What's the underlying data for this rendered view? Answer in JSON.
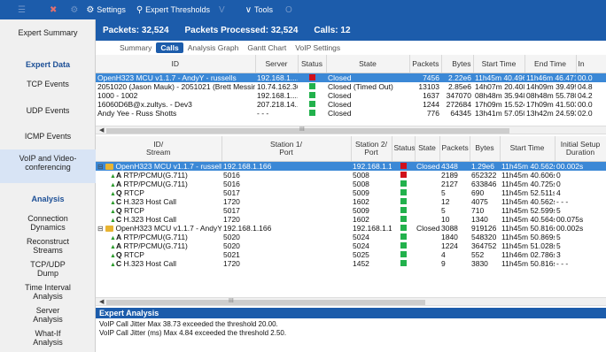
{
  "toolbar": {
    "ghosts": [
      "☰",
      "✖",
      "⚙"
    ],
    "settings": "Settings",
    "thresholds": "Expert Thresholds",
    "ghost_mid": "V",
    "tools": "Tools",
    "ghost_end": "O"
  },
  "sidebar": {
    "expert_summary": "Expert Summary",
    "expert_data_head": "Expert Data",
    "tcp_events": "TCP Events",
    "udp_events": "UDP Events",
    "icmp_events": "ICMP Events",
    "voip_video": "VoIP and Video-conferencing",
    "analysis_head": "Analysis",
    "connection_dynamics": "Connection Dynamics",
    "reconstruct_streams": "Reconstruct Streams",
    "tcp_udp_dump": "TCP/UDP Dump",
    "time_interval": "Time Interval Analysis",
    "server_analysis": "Server Analysis",
    "what_if": "What-If Analysis"
  },
  "stats": {
    "packets": "Packets: 32,524",
    "processed": "Packets Processed: 32,524",
    "calls": "Calls: 12"
  },
  "tabs": [
    "Summary",
    "Calls",
    "Analysis Graph",
    "Gantt Chart",
    "VoIP Settings"
  ],
  "calls_table": {
    "headers": [
      "ID",
      "Server",
      "Status",
      "State",
      "Packets",
      "Bytes",
      "Start Time",
      "End Time",
      "In"
    ],
    "rows": [
      {
        "id": "OpenH323 MCU v1.1.7 - AndyY - russells",
        "server": "192.168.1....",
        "status": "red",
        "state": "Closed",
        "packets": "7456",
        "bytes": "2.22e6",
        "start": "11h45m 40.496s",
        "end": "11h46m 46.471s",
        "extra": "00.0"
      },
      {
        "id": "2051020 (Jason Mauk) - 2051021 (Brett Messinger)",
        "server": "10.74.162.36",
        "status": "green",
        "state": "Closed (Timed Out)",
        "packets": "13103",
        "bytes": "2.85e6",
        "start": "14h07m 20.408s",
        "end": "14h09m 39.499s",
        "extra": "04.8"
      },
      {
        "id": "1000 - 1002",
        "server": "192.168.1....",
        "status": "green",
        "state": "Closed",
        "packets": "1637",
        "bytes": "347070",
        "start": "08h48m 35.948s",
        "end": "08h48m 55.780s",
        "extra": "04.2"
      },
      {
        "id": "16060D6B@x.zultys. - Dev3",
        "server": "207.218.14...",
        "status": "green",
        "state": "Closed",
        "packets": "1244",
        "bytes": "272684",
        "start": "17h09m 15.524s",
        "end": "17h09m 41.503s",
        "extra": "00.0"
      },
      {
        "id": "Andy Yee - Russ Shotts",
        "server": "- - -",
        "status": "green",
        "state": "Closed",
        "packets": "776",
        "bytes": "64345",
        "start": "13h41m 57.050s",
        "end": "13h42m 24.593s",
        "extra": "02.0"
      }
    ]
  },
  "scroll_mid": "III",
  "streams_table": {
    "headers": [
      "ID/\nStream",
      "Station 1/\nPort",
      "Station 2/\nPort",
      "Status",
      "State",
      "Packets",
      "Bytes",
      "Start Time",
      "Initial Setup\nDuration"
    ],
    "rows": [
      {
        "kind": "call",
        "expand": "⊟",
        "id": "OpenH323 MCU v1.1.7 - russells",
        "st1": "192.168.1.166",
        "st2": "192.168.1.173",
        "status": "red",
        "state": "Closed",
        "packets": "4348",
        "bytes": "1.29e6",
        "start": "11h45m 40.562s",
        "setup": "00.002s",
        "selected": true
      },
      {
        "kind": "stream",
        "letter": "A",
        "id": "RTP/PCMU(G.711)",
        "st1": "5016",
        "st2": "5008",
        "status": "red",
        "state": "",
        "packets": "2189",
        "bytes": "652322",
        "start": "11h45m 40.606s",
        "setup": "0"
      },
      {
        "kind": "stream",
        "letter": "A",
        "id": "RTP/PCMU(G.711)",
        "st1": "5016",
        "st2": "5008",
        "status": "green",
        "state": "",
        "packets": "2127",
        "bytes": "633846",
        "start": "11h45m 40.725s",
        "setup": "0"
      },
      {
        "kind": "stream",
        "letter": "Q",
        "id": "RTCP",
        "st1": "5017",
        "st2": "5009",
        "status": "green",
        "state": "",
        "packets": "5",
        "bytes": "690",
        "start": "11h45m 52.511s",
        "setup": "4"
      },
      {
        "kind": "stream",
        "letter": "C",
        "id": "H.323 Host Call",
        "st1": "1720",
        "st2": "1602",
        "status": "green",
        "state": "",
        "packets": "12",
        "bytes": "4075",
        "start": "11h45m 40.562s",
        "setup": "- - -"
      },
      {
        "kind": "stream",
        "letter": "Q",
        "id": "RTCP",
        "st1": "5017",
        "st2": "5009",
        "status": "green",
        "state": "",
        "packets": "5",
        "bytes": "710",
        "start": "11h45m 52.599s",
        "setup": "5"
      },
      {
        "kind": "stream",
        "letter": "C",
        "id": "H.323 Host Call",
        "st1": "1720",
        "st2": "1602",
        "status": "green",
        "state": "",
        "packets": "10",
        "bytes": "1340",
        "start": "11h45m 40.564s",
        "setup": "00.075s"
      },
      {
        "kind": "call",
        "expand": "⊟",
        "id": "OpenH323 MCU v1.1.7 - AndyY",
        "st1": "192.168.1.166",
        "st2": "192.168.1.167",
        "status": "green",
        "state": "Closed",
        "packets": "3088",
        "bytes": "919126",
        "start": "11h45m 50.816s",
        "setup": "00.002s"
      },
      {
        "kind": "stream",
        "letter": "A",
        "id": "RTP/PCMU(G.711)",
        "st1": "5020",
        "st2": "5024",
        "status": "green",
        "state": "",
        "packets": "1840",
        "bytes": "548320",
        "start": "11h45m 50.869s",
        "setup": "5"
      },
      {
        "kind": "stream",
        "letter": "A",
        "id": "RTP/PCMU(G.711)",
        "st1": "5020",
        "st2": "5024",
        "status": "green",
        "state": "",
        "packets": "1224",
        "bytes": "364752",
        "start": "11h45m 51.028s",
        "setup": "5"
      },
      {
        "kind": "stream",
        "letter": "Q",
        "id": "RTCP",
        "st1": "5021",
        "st2": "5025",
        "status": "green",
        "state": "",
        "packets": "4",
        "bytes": "552",
        "start": "11h46m 02.786s",
        "setup": "3"
      },
      {
        "kind": "stream",
        "letter": "C",
        "id": "H.323 Host Call",
        "st1": "1720",
        "st2": "1452",
        "status": "green",
        "state": "",
        "packets": "9",
        "bytes": "3830",
        "start": "11h45m 50.816s",
        "setup": "- - -"
      }
    ]
  },
  "expert_analysis": {
    "title": "Expert Analysis",
    "lines": [
      "VoIP Call Jitter Max 38.73 exceeded the threshold 20.00.",
      "VoIP Call Jitter (ms) Max 4.84 exceeded the threshold 2.50."
    ]
  },
  "colors": {
    "accent": "#1c5cab",
    "selected": "#3b88d6",
    "red": "#d0101b",
    "green": "#22b14c"
  }
}
